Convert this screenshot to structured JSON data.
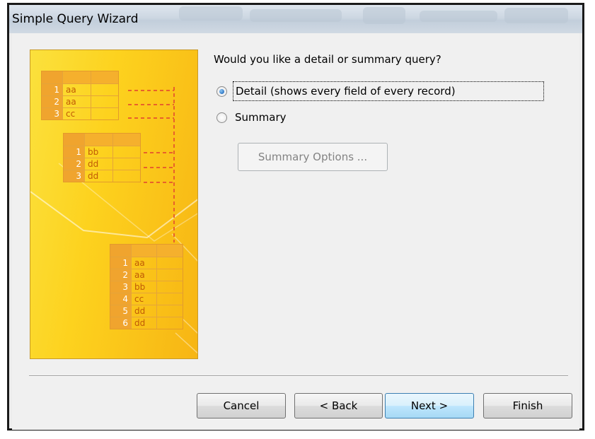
{
  "window": {
    "title": "Simple Query Wizard"
  },
  "illustration": {
    "table_top": [
      [
        "1",
        "aa"
      ],
      [
        "2",
        "aa"
      ],
      [
        "3",
        "cc"
      ]
    ],
    "table_mid": [
      [
        "1",
        "bb"
      ],
      [
        "2",
        "dd"
      ],
      [
        "3",
        "dd"
      ]
    ],
    "table_result": [
      [
        "1",
        "aa"
      ],
      [
        "2",
        "aa"
      ],
      [
        "3",
        "bb"
      ],
      [
        "4",
        "cc"
      ],
      [
        "5",
        "dd"
      ],
      [
        "6",
        "dd"
      ]
    ]
  },
  "question": "Would you like a detail or summary query?",
  "options": {
    "detail": {
      "label": "Detail (shows every field of every record)",
      "selected": true
    },
    "summary": {
      "label": "Summary",
      "selected": false
    }
  },
  "summary_options_label": "Summary Options ...",
  "buttons": {
    "cancel": "Cancel",
    "back": "< Back",
    "next": "Next >",
    "finish": "Finish"
  }
}
